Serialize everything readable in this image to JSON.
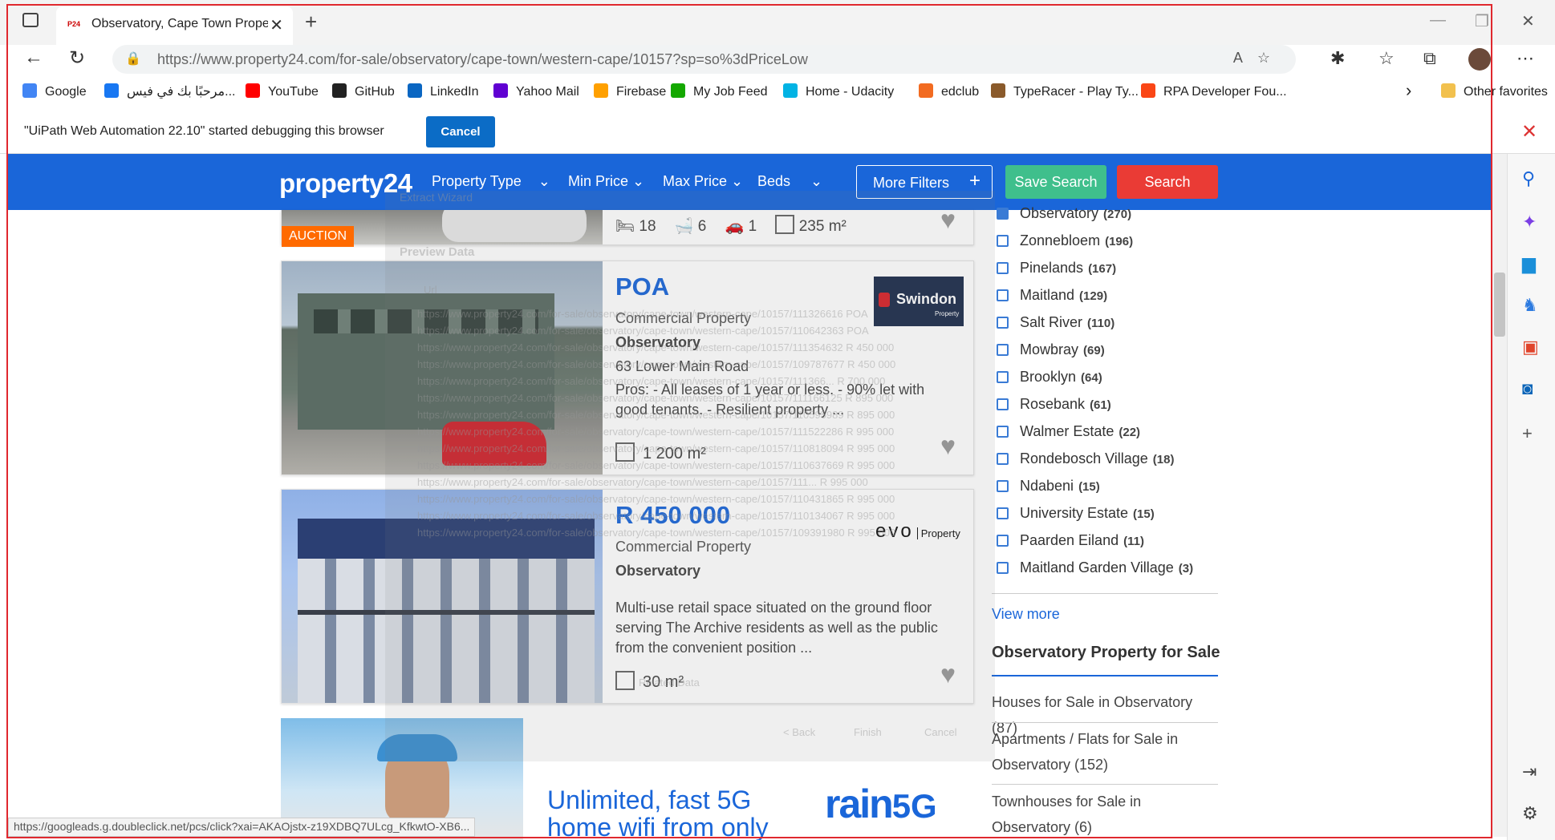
{
  "browser": {
    "tab_title": "Observatory, Cape Town Propert",
    "tab_favicon": "P24",
    "url": "https://www.property24.com/for-sale/observatory/cape-town/western-cape/10157?sp=so%3dPriceLow",
    "favorites": [
      {
        "label": "Google",
        "icon": "google-icon",
        "color": "#4285f4"
      },
      {
        "label": "مرحبًا بك في فيس...",
        "icon": "facebook-icon",
        "color": "#1877f2"
      },
      {
        "label": "YouTube",
        "icon": "youtube-icon",
        "color": "#ff0000"
      },
      {
        "label": "GitHub",
        "icon": "github-icon",
        "color": "#222222"
      },
      {
        "label": "LinkedIn",
        "icon": "linkedin-icon",
        "color": "#0a66c2"
      },
      {
        "label": "Yahoo Mail",
        "icon": "yahoo-icon",
        "color": "#6001d2"
      },
      {
        "label": "Firebase",
        "icon": "firebase-icon",
        "color": "#ffa000"
      },
      {
        "label": "My Job Feed",
        "icon": "upwork-icon",
        "color": "#14a800"
      },
      {
        "label": "Home - Udacity",
        "icon": "udacity-icon",
        "color": "#02b3e4"
      },
      {
        "label": "edclub",
        "icon": "edclub-icon",
        "color": "#f26b21"
      },
      {
        "label": "TypeRacer - Play Ty...",
        "icon": "typeracer-icon",
        "color": "#8a5a2b"
      },
      {
        "label": "RPA Developer Fou...",
        "icon": "uipath-icon",
        "color": "#fa4616"
      }
    ],
    "other_favorites": "Other favorites",
    "debug_message": "\"UiPath Web Automation 22.10\" started debugging this browser",
    "debug_cancel": "Cancel",
    "status_url": "https://googleads.g.doubleclick.net/pcs/click?xai=AKAOjstx-z19XDBQ7ULcg_KfkwtO-XB6..."
  },
  "header": {
    "logo": "property24",
    "nav": [
      "Property Type",
      "Min Price",
      "Max Price",
      "Beds"
    ],
    "more_filters": "More Filters",
    "save_search": "Save Search",
    "search": "Search"
  },
  "listings": [
    {
      "badge": "AUCTION",
      "beds": "18",
      "baths": "6",
      "garages": "1",
      "size": "235 m²"
    },
    {
      "price": "POA",
      "type": "Commercial Property",
      "suburb": "Observatory",
      "address": "63 Lower Main Road",
      "description": "Pros: - All leases of 1 year or less. - 90% let with good tenants. - Resilient property ...",
      "size": "1 200 m²",
      "agency": "Swindon",
      "agency_sub": "Property"
    },
    {
      "price": "R 450 000",
      "type": "Commercial Property",
      "suburb": "Observatory",
      "description": "Multi-use retail space situated on the ground floor serving The Archive residents as well as the public from the convenient position ...",
      "size": "30 m²",
      "agency": "evo",
      "agency_sub": "Property"
    }
  ],
  "filters": {
    "areas": [
      {
        "name": "Observatory",
        "count": "(270)",
        "checked": true
      },
      {
        "name": "Zonnebloem",
        "count": "(196)"
      },
      {
        "name": "Pinelands",
        "count": "(167)"
      },
      {
        "name": "Maitland",
        "count": "(129)"
      },
      {
        "name": "Salt River",
        "count": "(110)"
      },
      {
        "name": "Mowbray",
        "count": "(69)"
      },
      {
        "name": "Brooklyn",
        "count": "(64)"
      },
      {
        "name": "Rosebank",
        "count": "(61)"
      },
      {
        "name": "Walmer Estate",
        "count": "(22)"
      },
      {
        "name": "Rondebosch Village",
        "count": "(18)"
      },
      {
        "name": "Ndabeni",
        "count": "(15)"
      },
      {
        "name": "University Estate",
        "count": "(15)"
      },
      {
        "name": "Paarden Eiland",
        "count": "(11)"
      },
      {
        "name": "Maitland Garden Village",
        "count": "(3)"
      }
    ],
    "view_more": "View more",
    "section_title": "Observatory Property for Sale",
    "related": [
      "Houses for Sale in Observatory (87)",
      "Apartments / Flats for Sale in Observatory (152)",
      "Townhouses for Sale in Observatory (6)"
    ]
  },
  "ad": {
    "headline1": "Unlimited, fast 5G",
    "headline2": "home wifi from only",
    "brand": "rain",
    "brand_suffix": "5G"
  },
  "ghost": {
    "title": "Extract Wizard",
    "preview": "Preview Data",
    "col": "Url",
    "rows": [
      "https://www.property24.com/for-sale/observatory/cape-town/western-cape/10157/111326616  POA",
      "https://www.property24.com/for-sale/observatory/cape-town/western-cape/10157/110642363  POA",
      "https://www.property24.com/for-sale/observatory/cape-town/western-cape/10157/111354632  R 450 000",
      "https://www.property24.com/for-sale/observatory/cape-town/western-cape/10157/109787677  R 450 000",
      "https://www.property24.com/for-sale/observatory/cape-town/western-cape/10157/111366...  R 700 000",
      "https://www.property24.com/for-sale/observatory/cape-town/western-cape/10157/111166125  R 895 000",
      "https://www.property24.com/for-sale/observatory/cape-town/western-cape/10157/110595989  R 895 000",
      "https://www.property24.com/for-sale/observatory/cape-town/western-cape/10157/111522286  R 995 000",
      "https://www.property24.com/for-sale/observatory/cape-town/western-cape/10157/110818094  R 995 000",
      "https://www.property24.com/for-sale/observatory/cape-town/western-cape/10157/110637669  R 995 000",
      "https://www.property24.com/for-sale/observatory/cape-town/western-cape/10157/111...  R 995 000",
      "https://www.property24.com/for-sale/observatory/cape-town/western-cape/10157/110431865  R 995 000",
      "https://www.property24.com/for-sale/observatory/cape-town/western-cape/10157/110134067  R 995 000",
      "https://www.property24.com/for-sale/observatory/cape-town/western-cape/10157/109391980  R 995 000"
    ],
    "related_data": "Related Data",
    "back": "< Back",
    "finish": "Finish",
    "cancel": "Cancel"
  },
  "colors": {
    "brand_blue": "#1a66d9",
    "save_green": "#3fbf8c",
    "search_red": "#ea3b35",
    "auction_orange": "#ff6a00"
  }
}
